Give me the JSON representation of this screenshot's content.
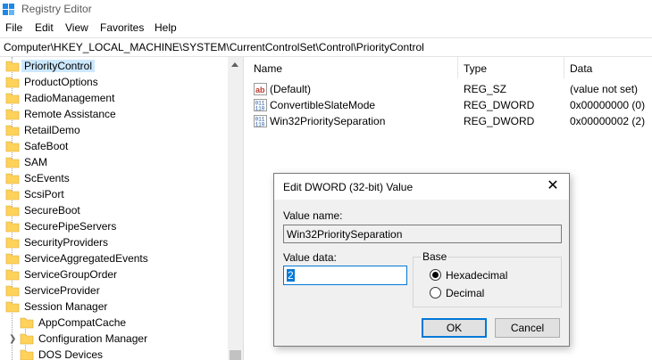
{
  "window": {
    "title": "Registry Editor"
  },
  "menu": [
    "File",
    "Edit",
    "View",
    "Favorites",
    "Help"
  ],
  "address": "Computer\\HKEY_LOCAL_MACHINE\\SYSTEM\\CurrentControlSet\\Control\\PriorityControl",
  "tree": {
    "items": [
      "PriorityControl",
      "ProductOptions",
      "RadioManagement",
      "Remote Assistance",
      "RetailDemo",
      "SafeBoot",
      "SAM",
      "ScEvents",
      "ScsiPort",
      "SecureBoot",
      "SecurePipeServers",
      "SecurityProviders",
      "ServiceAggregatedEvents",
      "ServiceGroupOrder",
      "ServiceProvider",
      "Session Manager"
    ],
    "children": [
      "AppCompatCache",
      "Configuration Manager",
      "DOS Devices"
    ],
    "selected": "PriorityControl"
  },
  "list": {
    "columns": [
      "Name",
      "Type",
      "Data"
    ],
    "rows": [
      {
        "name": "(Default)",
        "type": "REG_SZ",
        "data": "(value not set)",
        "icon": "string-value-icon"
      },
      {
        "name": "ConvertibleSlateMode",
        "type": "REG_DWORD",
        "data": "0x00000000 (0)",
        "icon": "binary-value-icon"
      },
      {
        "name": "Win32PrioritySeparation",
        "type": "REG_DWORD",
        "data": "0x00000002 (2)",
        "icon": "binary-value-icon"
      }
    ]
  },
  "dialog": {
    "title": "Edit DWORD (32-bit) Value",
    "value_name_label": "Value name:",
    "value_name": "Win32PrioritySeparation",
    "value_data_label": "Value data:",
    "value_data": "2",
    "base_label": "Base",
    "base_options": [
      "Hexadecimal",
      "Decimal"
    ],
    "base_selected": "Hexadecimal",
    "ok_label": "OK",
    "cancel_label": "Cancel"
  },
  "colors": {
    "accent": "#0078d7",
    "selection": "#cce8ff",
    "folder": "#ffd25a"
  }
}
